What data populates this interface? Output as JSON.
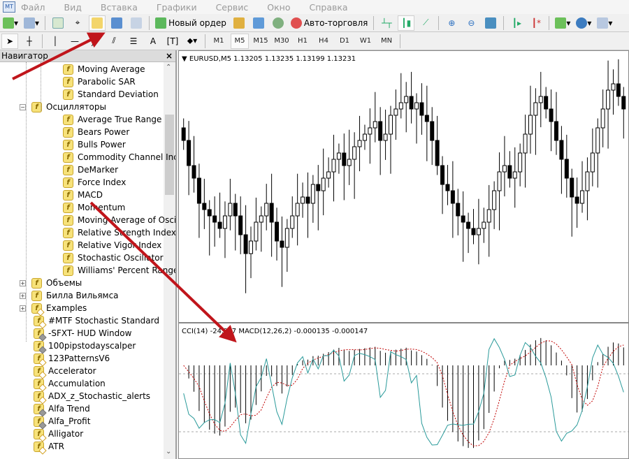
{
  "menu": [
    "Файл",
    "Вид",
    "Вставка",
    "Графики",
    "Сервис",
    "Окно",
    "Справка"
  ],
  "toolbar": {
    "new_order": "Новый ордер",
    "auto_trading": "Авто-торговля",
    "text_tool": "A"
  },
  "timeframes": [
    "M1",
    "M5",
    "M15",
    "M30",
    "H1",
    "H4",
    "D1",
    "W1",
    "MN"
  ],
  "active_timeframe": "M5",
  "navigator": {
    "title": "Навигатор",
    "close": "×",
    "items": [
      {
        "label": "Moving Average",
        "level": 2,
        "icon": "function-icon"
      },
      {
        "label": "Parabolic SAR",
        "level": 2,
        "icon": "function-icon"
      },
      {
        "label": "Standard Deviation",
        "level": 2,
        "icon": "function-icon"
      },
      {
        "label": "Осцилляторы",
        "level": 1,
        "icon": "function-icon",
        "expand": "-"
      },
      {
        "label": "Average True Range",
        "level": 2,
        "icon": "function-icon"
      },
      {
        "label": "Bears Power",
        "level": 2,
        "icon": "function-icon"
      },
      {
        "label": "Bulls Power",
        "level": 2,
        "icon": "function-icon"
      },
      {
        "label": "Commodity Channel Index",
        "level": 2,
        "icon": "function-icon"
      },
      {
        "label": "DeMarker",
        "level": 2,
        "icon": "function-icon"
      },
      {
        "label": "Force Index",
        "level": 2,
        "icon": "function-icon"
      },
      {
        "label": "MACD",
        "level": 2,
        "icon": "function-icon"
      },
      {
        "label": "Momentum",
        "level": 2,
        "icon": "function-icon"
      },
      {
        "label": "Moving Average of Oscillator",
        "level": 2,
        "icon": "function-icon"
      },
      {
        "label": "Relative Strength Index",
        "level": 2,
        "icon": "function-icon"
      },
      {
        "label": "Relative Vigor Index",
        "level": 2,
        "icon": "function-icon"
      },
      {
        "label": "Stochastic Oscillator",
        "level": 2,
        "icon": "function-icon"
      },
      {
        "label": "Williams' Percent Range",
        "level": 2,
        "icon": "function-icon"
      },
      {
        "label": "Объемы",
        "level": 1,
        "icon": "function-icon",
        "expand": "+"
      },
      {
        "label": "Билла Вильямса",
        "level": 1,
        "icon": "function-icon",
        "expand": "+"
      },
      {
        "label": "Examples",
        "level": 1,
        "icon": "custom-function-icon",
        "expand": "+"
      },
      {
        "label": "#MTF Stochastic Standard",
        "level": 1,
        "icon": "custom-function-icon"
      },
      {
        "label": "-SFXT- HUD Window",
        "level": 1,
        "icon": "compiled-function-icon"
      },
      {
        "label": "100pipstodayscalper",
        "level": 1,
        "icon": "compiled-function-icon"
      },
      {
        "label": "123PatternsV6",
        "level": 1,
        "icon": "custom-function-icon"
      },
      {
        "label": "Accelerator",
        "level": 1,
        "icon": "custom-function-icon"
      },
      {
        "label": "Accumulation",
        "level": 1,
        "icon": "custom-function-icon"
      },
      {
        "label": "ADX_z_Stochastic_alerts",
        "level": 1,
        "icon": "custom-function-icon"
      },
      {
        "label": "Alfa Trend",
        "level": 1,
        "icon": "compiled-function-icon"
      },
      {
        "label": "Alfa_Profit",
        "level": 1,
        "icon": "compiled-function-icon"
      },
      {
        "label": "Alligator",
        "level": 1,
        "icon": "custom-function-icon"
      },
      {
        "label": "ATR",
        "level": 1,
        "icon": "custom-function-icon"
      }
    ]
  },
  "chart": {
    "symbol_label": "EURUSD,M5  1.13205 1.13235 1.13199 1.13231",
    "indicator_label": "CCI(14) -24.?07  MACD(12,26,2) -0.000135 -0.000147",
    "colors": {
      "candle": "#000000",
      "macd_signal": "#c00000",
      "cci": "#2a9a9a",
      "annotation_arrow": "#c0151b"
    },
    "price_ylim": [
      1.1292,
      1.1332
    ],
    "closes": [
      1.132,
      1.1316,
      1.1314,
      1.131,
      1.1309,
      1.1308,
      1.1307,
      1.1306,
      1.1308,
      1.131,
      1.1308,
      1.1305,
      1.1302,
      1.1304,
      1.1307,
      1.1308,
      1.131,
      1.1307,
      1.1304,
      1.1303,
      1.1306,
      1.1308,
      1.131,
      1.1311,
      1.131,
      1.1313,
      1.1312,
      1.1314,
      1.1315,
      1.1317,
      1.1318,
      1.1316,
      1.1317,
      1.1319,
      1.132,
      1.1321,
      1.1322,
      1.1323,
      1.132,
      1.1321,
      1.1324,
      1.1325,
      1.1326,
      1.1327,
      1.1325,
      1.1326,
      1.1324,
      1.1323,
      1.132,
      1.1316,
      1.1313,
      1.1312,
      1.131,
      1.1308,
      1.1307,
      1.1306,
      1.1305,
      1.1306,
      1.1307,
      1.1309,
      1.1312,
      1.1315,
      1.1316,
      1.1314,
      1.1315,
      1.1318,
      1.1321,
      1.1324,
      1.1326,
      1.1327,
      1.1325,
      1.1323,
      1.132,
      1.1317,
      1.1314,
      1.1311,
      1.131,
      1.1312,
      1.1315,
      1.1318,
      1.1322,
      1.1325,
      1.1328,
      1.1329,
      1.1327,
      1.1325
    ]
  }
}
